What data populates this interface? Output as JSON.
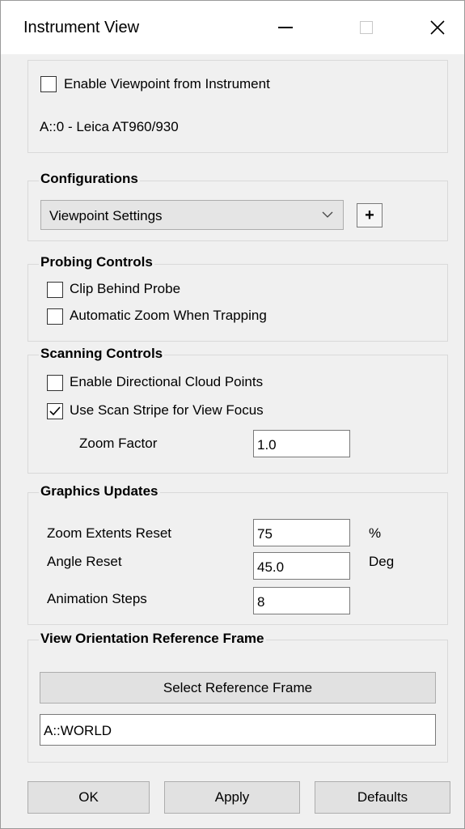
{
  "window": {
    "title": "Instrument View",
    "controls": {
      "minimize": "minimize",
      "maximize": "maximize",
      "close": "close"
    }
  },
  "instrument": {
    "enable_viewpoint_label": "Enable Viewpoint from Instrument",
    "enable_viewpoint_checked": false,
    "instrument_name": "A::0 - Leica AT960/930"
  },
  "configurations": {
    "title": "Configurations",
    "selected": "Viewpoint Settings",
    "add_label": "+"
  },
  "probing": {
    "title": "Probing Controls",
    "clip_label": "Clip Behind Probe",
    "clip_checked": false,
    "zoom_trap_label": "Automatic Zoom When Trapping",
    "zoom_trap_checked": false
  },
  "scanning": {
    "title": "Scanning Controls",
    "directional_label": "Enable Directional Cloud Points",
    "directional_checked": false,
    "scan_stripe_label": "Use Scan Stripe for View Focus",
    "scan_stripe_checked": true,
    "zoom_factor_label": "Zoom Factor",
    "zoom_factor_value": "1.0"
  },
  "graphics": {
    "title": "Graphics Updates",
    "zoom_extents_label": "Zoom Extents Reset",
    "zoom_extents_value": "75",
    "zoom_extents_unit": "%",
    "angle_reset_label": "Angle Reset",
    "angle_reset_value": "45.0",
    "angle_reset_unit": "Deg",
    "animation_steps_label": "Animation Steps",
    "animation_steps_value": "8"
  },
  "reference_frame": {
    "title": "View Orientation Reference Frame",
    "select_button": "Select Reference Frame",
    "frame_value": "A::WORLD"
  },
  "footer": {
    "ok": "OK",
    "apply": "Apply",
    "defaults": "Defaults"
  },
  "colors": {
    "dialog_bg": "#f0f0f0",
    "titlebar_bg": "#ffffff",
    "button_bg": "#e1e1e1",
    "group_border": "#d9d9d9"
  }
}
